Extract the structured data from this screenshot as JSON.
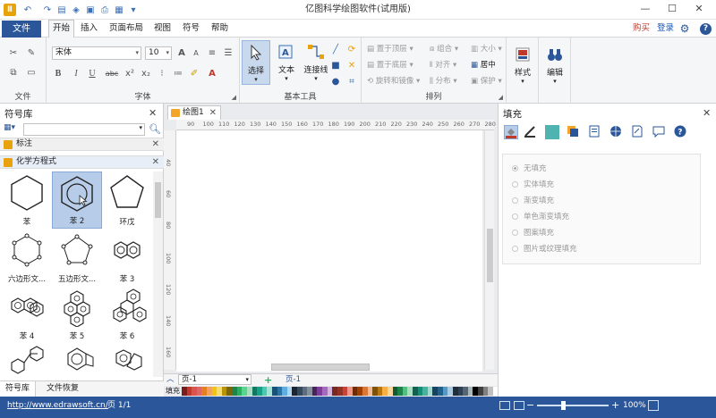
{
  "window": {
    "title": "亿图科学绘图软件(试用版)",
    "minimize": "—",
    "maximize": "☐",
    "close": "✕"
  },
  "menu": {
    "file": "文件",
    "tabs": [
      "开始",
      "插入",
      "页面布局",
      "视图",
      "符号",
      "帮助"
    ],
    "active_tab": "开始",
    "buy": "购买",
    "login": "登录"
  },
  "ribbon": {
    "file_group": {
      "label": "文件"
    },
    "font_group": {
      "label": "字体",
      "font_name": "宋体",
      "font_size": "10",
      "bold": "B",
      "italic": "I",
      "underline": "U",
      "strike": "abc",
      "grow": "A",
      "shrink": "A"
    },
    "tools_group": {
      "label": "基本工具",
      "select": "选择",
      "text": "文本",
      "connector": "连接线"
    },
    "arrange_group": {
      "label": "排列",
      "bring_front": "置于顶层",
      "send_back": "置于底层",
      "rotate": "旋转和镜像",
      "group": "组合",
      "align": "对齐",
      "distribute": "分布",
      "size": "大小",
      "center": "居中",
      "protect": "保护"
    },
    "style": "样式",
    "edit": "编辑"
  },
  "symbol_panel": {
    "title": "符号库",
    "categories": [
      "标注",
      "化学方程式"
    ],
    "symbols": [
      {
        "label": "苯",
        "shape": "hexagon"
      },
      {
        "label": "苯 2",
        "shape": "hexagon-circle"
      },
      {
        "label": "环戊",
        "shape": "pentagon"
      },
      {
        "label": "六边形文...",
        "shape": "hexagon-dots"
      },
      {
        "label": "五边形文...",
        "shape": "pentagon-dots"
      },
      {
        "label": "苯 3",
        "shape": "naphthalene"
      },
      {
        "label": "苯 4",
        "shape": "phenanthrene"
      },
      {
        "label": "苯 5",
        "shape": "pyrene"
      },
      {
        "label": "苯 6",
        "shape": "triphenylene"
      },
      {
        "label": "",
        "shape": "biphenyl"
      },
      {
        "label": "",
        "shape": "fluorene"
      },
      {
        "label": "",
        "shape": "indene"
      }
    ],
    "tabs": [
      "符号库",
      "文件恢复"
    ]
  },
  "canvas": {
    "doc_tab": "绘图1",
    "hruler_ticks": [
      "90",
      "100",
      "110",
      "120",
      "130",
      "140",
      "150",
      "160",
      "170",
      "180",
      "190",
      "200",
      "210",
      "220",
      "230",
      "240",
      "250",
      "260",
      "270",
      "280"
    ],
    "vruler_ticks": [
      "40",
      "60",
      "80",
      "100",
      "120",
      "140",
      "160"
    ],
    "page_select": "页-1",
    "page_tab": "页-1",
    "fill_label": "填充"
  },
  "palette": [
    "#7a1d1d",
    "#c0392b",
    "#d9534f",
    "#e06666",
    "#e67e22",
    "#f0a35e",
    "#f1c40f",
    "#f7dc6f",
    "#b7950b",
    "#7d6608",
    "#1e8449",
    "#27ae60",
    "#58d68d",
    "#a9dfbf",
    "#117864",
    "#16a085",
    "#48c9b0",
    "#a3e4d7",
    "#1a5276",
    "#2874a6",
    "#5dade2",
    "#aed6f1",
    "#1b2631",
    "#34495e",
    "#5d6d7e",
    "#85929e",
    "#4a235a",
    "#7d3c98",
    "#a569bd",
    "#d2b4de",
    "#78281f",
    "#943126",
    "#cb4335",
    "#f1948a",
    "#6e2c00",
    "#a04000",
    "#dc7633",
    "#edbb99",
    "#7e5109",
    "#b9770e",
    "#f5b041",
    "#fad7a0",
    "#145a32",
    "#1d8348",
    "#52be80",
    "#a9dfbf",
    "#0e6251",
    "#138d75",
    "#45b39d",
    "#a2d9ce",
    "#154360",
    "#1f618d",
    "#5499c7",
    "#a9cce3",
    "#212f3d",
    "#2e4053",
    "#566573",
    "#aab7b8",
    "#000000",
    "#404040",
    "#808080",
    "#c0c0c0",
    "#ffffff"
  ],
  "fill_panel": {
    "title": "填充",
    "options": [
      "无填充",
      "实体填充",
      "渐变填充",
      "单色渐变填充",
      "图案填充",
      "图片或纹理填充"
    ],
    "selected": "无填充"
  },
  "status": {
    "url": "http://www.edrawsoft.cn/",
    "page": "页 1/1",
    "zoom": "100%"
  }
}
